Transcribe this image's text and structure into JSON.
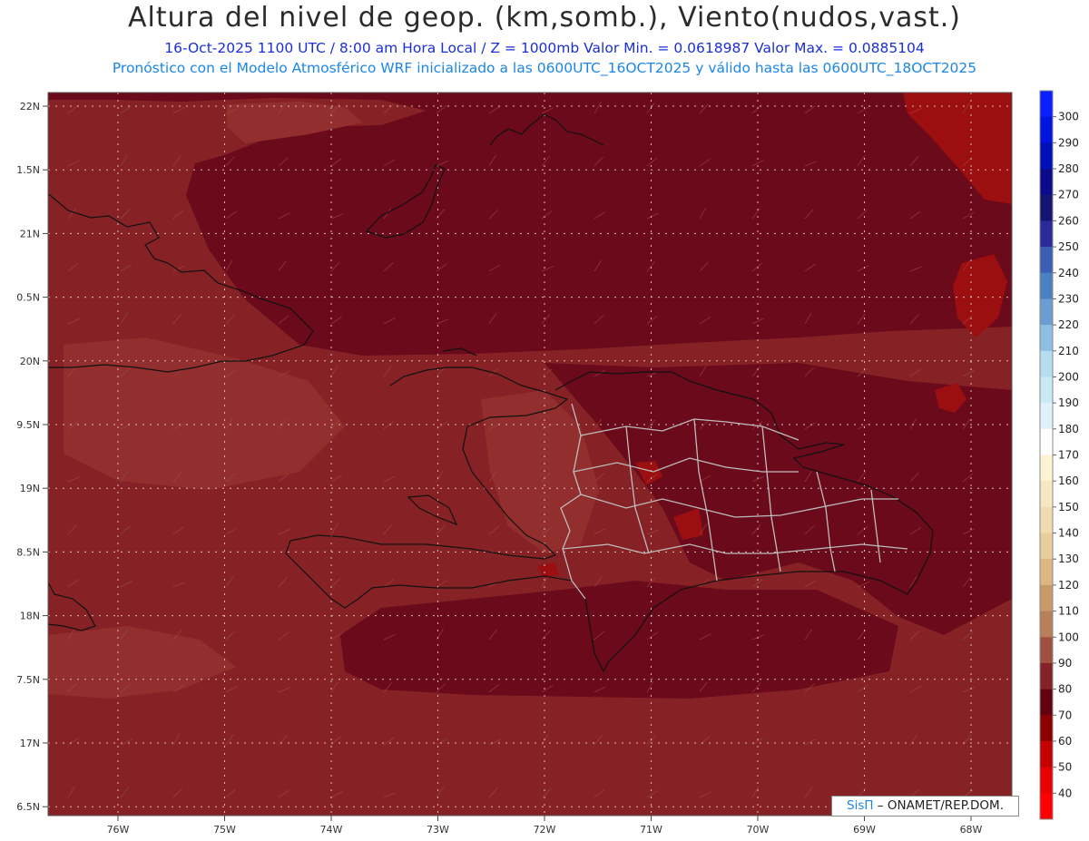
{
  "header": {
    "title": "Altura del nivel de geop. (km,somb.), Viento(nudos,vast.)",
    "line1": "16-Oct-2025  1100 UTC / 8:00 am Hora Local / Z = 1000mb Valor Min. = 0.0618987  Valor Max. = 0.0885104",
    "line2": "Pronóstico con el Modelo Atmosférico WRF inicializado a las 0600UTC_16OCT2025 y válido hasta las  0600UTC_18OCT2025"
  },
  "axes": {
    "lat_labels": [
      "22N",
      "1.5N",
      "21N",
      "0.5N",
      "20N",
      "9.5N",
      "19N",
      "8.5N",
      "18N",
      "7.5N",
      "17N",
      "6.5N"
    ],
    "lon_labels": [
      "76W",
      "75W",
      "74W",
      "73W",
      "72W",
      "71W",
      "70W",
      "69W",
      "68W"
    ]
  },
  "colorbar": {
    "labels": [
      "300",
      "290",
      "280",
      "270",
      "260",
      "250",
      "240",
      "230",
      "220",
      "210",
      "200",
      "190",
      "180",
      "170",
      "160",
      "150",
      "140",
      "130",
      "120",
      "110",
      "100",
      "90",
      "80",
      "70",
      "60",
      "50",
      "40"
    ],
    "colors": [
      "#0a1fff",
      "#0016e0",
      "#0010b8",
      "#0a0a8a",
      "#141472",
      "#2a2a9a",
      "#3a5fb5",
      "#4a80c4",
      "#6a9ed2",
      "#8ebfe2",
      "#b5dcef",
      "#c9e9f4",
      "#dff2fa",
      "#ffffff",
      "#fbf3d2",
      "#f5e8c2",
      "#f0dcb0",
      "#e8cc9a",
      "#dcb683",
      "#c89a68",
      "#b8805a",
      "#a05040",
      "#842228",
      "#620010",
      "#8a0000",
      "#c40000",
      "#e80000",
      "#ff0000"
    ],
    "field_colors": {
      "base": "#862226",
      "dark": "#6a0a1a",
      "light": "#922e2e",
      "red": "#9c0f10"
    }
  },
  "credit": {
    "brand": "SisΠ",
    "text": " – ONAMET/REP.DOM."
  }
}
